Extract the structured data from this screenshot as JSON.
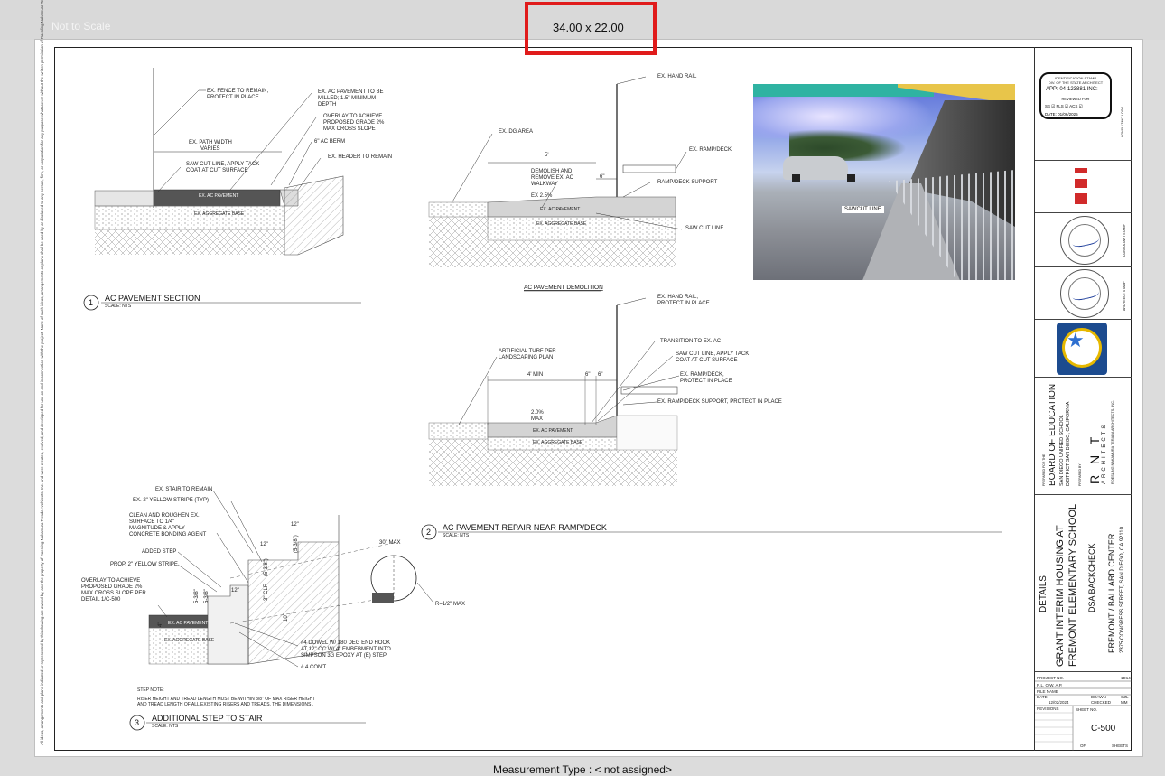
{
  "viewer": {
    "scale_label": "Not to Scale",
    "dimensions": "34.00 x 22.00",
    "measurement_type": "Measurement Type : < not assigned>"
  },
  "sheet": {
    "copyright_note": "All ideas, arrangements and plans indicated or represented by this drawing are owned by, and the property of Roesling Nakamura Terada Architects, Inc. and were created, evolved, and developed for use on and in connection with the project. None of such ideas, arrangements or plans shall be used by or disclosed to any person, firm, or corporation for any purpose whatsoever without the written permission of Roesling Nakamura Terada Architects, Inc."
  },
  "detail1": {
    "number": "1",
    "title": "AC PAVEMENT SECTION",
    "scale": "SCALE: NTS",
    "labels": {
      "fence": "EX. FENCE TO REMAIN,",
      "fence2": "PROTECT IN PLACE",
      "mill": "EX. AC PAVEMENT TO BE",
      "mill2": "MILLED; 1.5\" MINIMUM",
      "mill3": "DEPTH",
      "overlay": "OVERLAY TO ACHIEVE",
      "overlay2": "PROPOSED GRADE 2%",
      "overlay3": "MAX CROSS SLOPE",
      "path": "EX. PATH WIDTH",
      "path2": "VARIES",
      "berm": "6\" AC BERM",
      "header": "EX. HEADER TO REMAIN",
      "sawcut": "SAW CUT LINE, APPLY TACK",
      "sawcut2": "COAT AT CUT SURFACE",
      "ac": "EX. AC PAVEMENT",
      "agg": "EX. AGGREGATE BASE"
    }
  },
  "detail_demo": {
    "title": "AC PAVEMENT DEMOLITION",
    "labels": {
      "handrail": "EX. HAND RAIL",
      "dg": "EX. DG AREA",
      "ramp": "EX. RAMP/DECK",
      "dim5": "5'",
      "demolish": "DEMOLISH AND",
      "demolish2": "REMOVE EX. AC",
      "demolish3": "WALKWAY",
      "dim6": "6\"",
      "slope": "EX 2.5%",
      "support": "RAMP/DECK SUPPORT",
      "ac": "EX. AC PAVEMENT",
      "agg": "EX. AGGREGATE BASE",
      "sawcut": "SAW CUT LINE"
    }
  },
  "photo": {
    "label": "SAWCUT LINE"
  },
  "detail2": {
    "number": "2",
    "title": "AC PAVEMENT REPAIR NEAR RAMP/DECK",
    "scale": "SCALE: NTS",
    "labels": {
      "handrail": "EX. HAND RAIL,",
      "handrail2": "PROTECT IN PLACE",
      "transition": "TRANSITION TO EX. AC",
      "turf": "ARTIFICIAL TURF PER",
      "turf2": "LANDSCAPING PLAN",
      "sawcut": "SAW CUT LINE, APPLY TACK",
      "sawcut2": "COAT AT CUT SURFACE",
      "dim4": "4' MIN",
      "dim6a": "6\"",
      "dim6b": "6\"",
      "ramp": "EX. RAMP/DECK,",
      "ramp2": "PROTECT IN PLACE",
      "support": "EX. RAMP/DECK SUPPORT, PROTECT IN PLACE",
      "slope": "2.0%",
      "slope2": "MAX",
      "ac": "EX. AC PAVEMENT",
      "agg": "EX. AGGREGATE BASE"
    }
  },
  "detail3": {
    "number": "3",
    "title": "ADDITIONAL STEP TO STAIR",
    "scale": "SCALE: NTS",
    "labels": {
      "stair": "EX. STAIR TO REMAIN",
      "stripe": "EX. 2\" YELLOW STRIPE (TYP)",
      "clean": "CLEAN AND ROUGHEN EX.",
      "clean2": "SURFACE TO 1/4\"",
      "clean3": "MAGNITUDE & APPLY",
      "clean4": "CONCRETE BONDING AGENT",
      "added": "ADDED STEP",
      "prop": "PROP. 2\" YELLOW STRIPE",
      "overlay": "OVERLAY TO ACHIEVE",
      "overlay2": "PROPOSED GRADE 2%",
      "overlay3": "MAX CROSS SLOPE PER",
      "overlay4": "DETAIL 1/C-500",
      "ac": "EX. AC PAVEMENT",
      "agg": "EX. AGGREGATE BASE",
      "dowel": "#4 DOWEL W/ 180 DEG END HOOK",
      "dowel2": "AT 12\" OC W/ 4\" EMBEBMENT INTO",
      "dowel3": "SIMPSON 3G EPOXY AT (E) STEP",
      "cont": "# 4 CON'T",
      "d12a": "12\"",
      "d12b": "12\"",
      "d12c": "12\"",
      "d538a": "(5-3/8\")",
      "d538b": "(5-3/8\")",
      "d538c": "5-3/8\"",
      "d538d": "5-3/8\"",
      "clr": "3\" CLR",
      "d10": "10\"",
      "d4": "4\"",
      "max30": "30\" MAX",
      "rmax": "R=1/2\" MAX",
      "stepnote": "STEP NOTE:",
      "stepnote2": "RISER HEIGHT AND TREAD LENGTH MUST BE WITHIN 3/8\" OF MAX RISER HEIGHT",
      "stepnote3": "AND TREAD LENGTH OF ALL EXISTING RISERS AND TREADS. THE DIMENSIONS ."
    }
  },
  "titleblock": {
    "stamp_title": "IDENTIFICATION STAMP",
    "stamp_sub": "DIV. OF THE STATE ARCHITECT",
    "app": "APP: 04-123881 INC:",
    "reviewed": "REVIEWED FOR",
    "checks": "SS ☑   FLS ☑   ACS ☑",
    "date": "DATE:        01/06/2025",
    "consultant": "CONSULTANT LOGO",
    "consultant_stamp": "CONSULTANT STAMP",
    "architect_stamp": "ARCHITECT STAMP",
    "prepared_for": "PREPARED FOR THE",
    "board": "BOARD OF EDUCATION",
    "district": "SAN DIEGO UNIFIED SCHOOL",
    "district2": "DISTRICT  SAN DIEGO, CALIFORNIA",
    "prepared_by": "PREPARED BY",
    "firm": "R  N  T",
    "firm2": "ARCHITECTS",
    "firm3": "ROESLING NAKAMURA TERADA ARCHITECTS, INC.",
    "sheet_title": "DETAILS",
    "project": "GRANT INTERIM HOUSING AT",
    "project2": "FREMONT ELEMENTARY SCHOOL",
    "backcheck": "DSA BACKCHECK",
    "site": "FREMONT / BALLARD CENTER",
    "address": "2375 CONGRESS STREET, SAN DIEGO, CA 92110",
    "project_no_label": "PROJECT NO.",
    "project_no": "1D14",
    "by": "R.L.  O.W.        A.P.",
    "file_name": "FILE NAME",
    "date_label": "DATE",
    "date_val": "12/02/2024",
    "drawn": "DRAWN",
    "drawn_val": "CZL",
    "checked": "CHECKED",
    "checked_val": "MM",
    "revisions": "REVISIONS",
    "sheet_no_label": "SHEET NO.",
    "sheet_no": "C-500",
    "of": "OF",
    "sheets": "SHEETS"
  }
}
